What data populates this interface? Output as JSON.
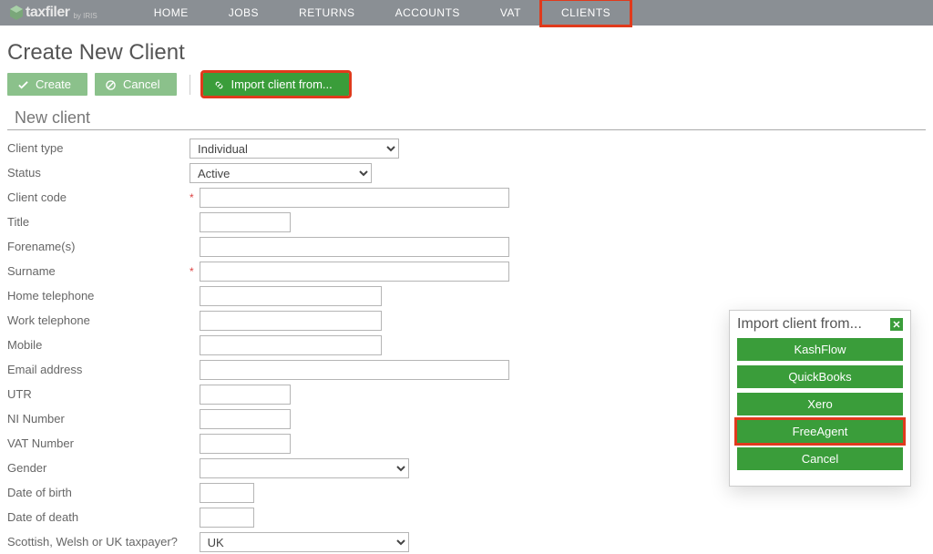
{
  "brand": {
    "name": "taxfiler",
    "by": "by IRIS"
  },
  "nav": {
    "items": [
      {
        "label": "HOME"
      },
      {
        "label": "JOBS"
      },
      {
        "label": "RETURNS"
      },
      {
        "label": "ACCOUNTS"
      },
      {
        "label": "VAT"
      },
      {
        "label": "CLIENTS",
        "highlighted": true
      }
    ]
  },
  "page": {
    "title": "Create New Client"
  },
  "actions": {
    "create": "Create",
    "cancel": "Cancel",
    "import": "Import client from..."
  },
  "section": {
    "title": "New client"
  },
  "form": {
    "client_type": {
      "label": "Client type",
      "value": "Individual"
    },
    "status": {
      "label": "Status",
      "value": "Active"
    },
    "client_code": {
      "label": "Client code",
      "required": true,
      "value": ""
    },
    "title": {
      "label": "Title",
      "value": ""
    },
    "forenames": {
      "label": "Forename(s)",
      "value": ""
    },
    "surname": {
      "label": "Surname",
      "required": true,
      "value": ""
    },
    "home_tel": {
      "label": "Home telephone",
      "value": ""
    },
    "work_tel": {
      "label": "Work telephone",
      "value": ""
    },
    "mobile": {
      "label": "Mobile",
      "value": ""
    },
    "email": {
      "label": "Email address",
      "value": ""
    },
    "utr": {
      "label": "UTR",
      "value": ""
    },
    "ni": {
      "label": "NI Number",
      "value": ""
    },
    "vat": {
      "label": "VAT Number",
      "value": ""
    },
    "gender": {
      "label": "Gender",
      "value": ""
    },
    "dob": {
      "label": "Date of birth",
      "value": ""
    },
    "dod": {
      "label": "Date of death",
      "value": ""
    },
    "taxpayer": {
      "label": "Scottish, Welsh or UK taxpayer?",
      "value": "UK"
    }
  },
  "modal": {
    "title": "Import client from...",
    "options": [
      {
        "label": "KashFlow"
      },
      {
        "label": "QuickBooks"
      },
      {
        "label": "Xero"
      },
      {
        "label": "FreeAgent",
        "highlighted": true
      },
      {
        "label": "Cancel"
      }
    ]
  }
}
